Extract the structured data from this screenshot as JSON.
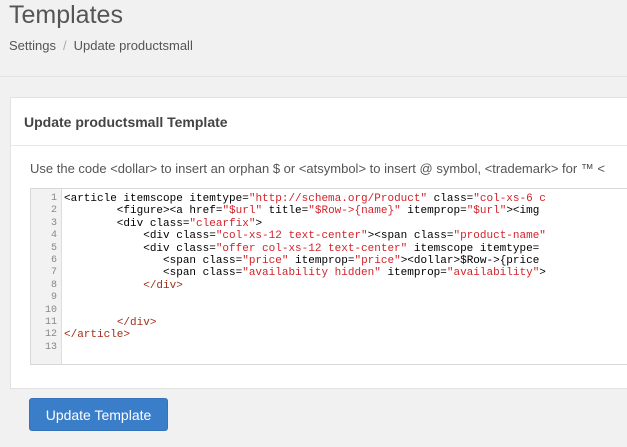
{
  "header": {
    "title": "Templates"
  },
  "breadcrumb": {
    "items": [
      "Settings",
      "Update productsmall"
    ],
    "separator": "/"
  },
  "panel": {
    "title": "Update productsmall Template",
    "hint": "Use the code <dollar> to insert an orphan $ or <atsymbol> to insert @ symbol, <trademark> for ™ <"
  },
  "editor": {
    "lines": [
      {
        "num": "1",
        "segments": [
          {
            "t": "<article itemscope itemtype=",
            "c": "tag"
          },
          {
            "t": "\"http://schema.org/Product\"",
            "c": "str"
          },
          {
            "t": " class=",
            "c": "attr"
          },
          {
            "t": "\"col-xs-6 c",
            "c": "str"
          }
        ]
      },
      {
        "num": "2",
        "segments": [
          {
            "t": "        <figure><a href=",
            "c": "tag"
          },
          {
            "t": "\"$url\"",
            "c": "str"
          },
          {
            "t": " title=",
            "c": "attr"
          },
          {
            "t": "\"$Row->{name}\"",
            "c": "str"
          },
          {
            "t": " itemprop=",
            "c": "attr"
          },
          {
            "t": "\"$url\"",
            "c": "str"
          },
          {
            "t": "><img",
            "c": "tag"
          }
        ]
      },
      {
        "num": "3",
        "segments": [
          {
            "t": "        <div class=",
            "c": "tag"
          },
          {
            "t": "\"clearfix\"",
            "c": "str"
          },
          {
            "t": ">",
            "c": "tag"
          }
        ]
      },
      {
        "num": "4",
        "segments": [
          {
            "t": "            <div class=",
            "c": "tag"
          },
          {
            "t": "\"col-xs-12 text-center\"",
            "c": "str"
          },
          {
            "t": "><span class=",
            "c": "tag"
          },
          {
            "t": "\"product-name\"",
            "c": "str"
          }
        ]
      },
      {
        "num": "5",
        "segments": [
          {
            "t": "            <div class=",
            "c": "tag"
          },
          {
            "t": "\"offer col-xs-12 text-center\"",
            "c": "str"
          },
          {
            "t": " itemscope itemtype=",
            "c": "attr"
          }
        ]
      },
      {
        "num": "6",
        "segments": [
          {
            "t": "               <span class=",
            "c": "tag"
          },
          {
            "t": "\"price\"",
            "c": "str"
          },
          {
            "t": " itemprop=",
            "c": "attr"
          },
          {
            "t": "\"price\"",
            "c": "str"
          },
          {
            "t": "><dollar>$Row->{price",
            "c": "tag"
          }
        ]
      },
      {
        "num": "7",
        "segments": [
          {
            "t": "               <span class=",
            "c": "tag"
          },
          {
            "t": "\"availability hidden\"",
            "c": "str"
          },
          {
            "t": " itemprop=",
            "c": "attr"
          },
          {
            "t": "\"availability\"",
            "c": "str"
          },
          {
            "t": ">",
            "c": "tag"
          }
        ]
      },
      {
        "num": "8",
        "segments": [
          {
            "t": "            ",
            "c": "tag"
          },
          {
            "t": "</div>",
            "c": "closetag"
          }
        ]
      },
      {
        "num": "9",
        "segments": []
      },
      {
        "num": "10",
        "segments": []
      },
      {
        "num": "11",
        "segments": [
          {
            "t": "        ",
            "c": "tag"
          },
          {
            "t": "</div>",
            "c": "closetag"
          }
        ]
      },
      {
        "num": "12",
        "segments": [
          {
            "t": "</article>",
            "c": "closetag"
          }
        ]
      },
      {
        "num": "13",
        "segments": []
      }
    ]
  },
  "actions": {
    "submit_label": "Update Template"
  }
}
